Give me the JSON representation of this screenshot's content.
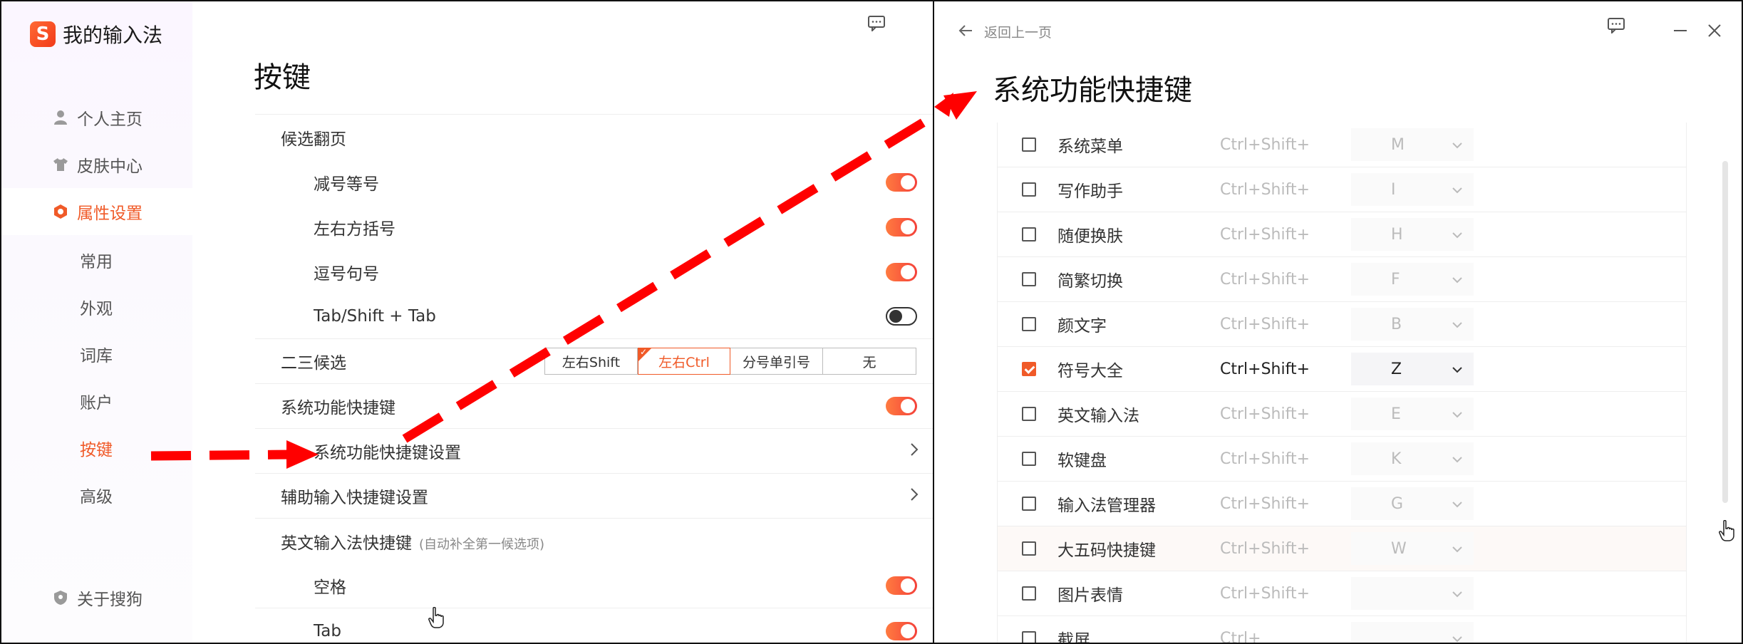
{
  "left": {
    "app_title": "我的输入法",
    "logo_char": "S",
    "nav": {
      "home": "个人主页",
      "skin": "皮肤中心",
      "props": "属性设置",
      "sub": [
        "常用",
        "外观",
        "词库",
        "账户",
        "按键",
        "高级"
      ],
      "active_sub": "按键",
      "about": "关于搜狗"
    },
    "page_title": "按键",
    "sections": {
      "candidate_page": "候选翻页",
      "minus_equal": "减号等号",
      "brackets": "左右方括号",
      "comma_period": "逗号句号",
      "tab_shift": "Tab/Shift + Tab",
      "two_three": "二三候选",
      "two_three_options": [
        "左右Shift",
        "左右Ctrl",
        "分号单引号",
        "无"
      ],
      "two_three_selected": "左右Ctrl",
      "sys_shortcut": "系统功能快捷键",
      "sys_shortcut_settings": "系统功能快捷键设置",
      "aux_shortcut_settings": "辅助输入快捷键设置",
      "en_shortcut": "英文输入法快捷键",
      "en_shortcut_note": "(自动补全第一候选项)",
      "space": "空格",
      "tab": "Tab"
    },
    "toggles": {
      "minus_equal": true,
      "brackets": true,
      "comma_period": true,
      "tab_shift": false,
      "sys_shortcut": true,
      "space": true,
      "tab": true
    }
  },
  "right": {
    "back_label": "返回上一页",
    "title": "系统功能快捷键",
    "rows": [
      {
        "name": "系统菜单",
        "mod": "Ctrl+Shift+",
        "key": "M",
        "checked": false
      },
      {
        "name": "写作助手",
        "mod": "Ctrl+Shift+",
        "key": "I",
        "checked": false
      },
      {
        "name": "随便换肤",
        "mod": "Ctrl+Shift+",
        "key": "H",
        "checked": false
      },
      {
        "name": "简繁切换",
        "mod": "Ctrl+Shift+",
        "key": "F",
        "checked": false
      },
      {
        "name": "颜文字",
        "mod": "Ctrl+Shift+",
        "key": "B",
        "checked": false
      },
      {
        "name": "符号大全",
        "mod": "Ctrl+Shift+",
        "key": "Z",
        "checked": true
      },
      {
        "name": "英文输入法",
        "mod": "Ctrl+Shift+",
        "key": "E",
        "checked": false
      },
      {
        "name": "软键盘",
        "mod": "Ctrl+Shift+",
        "key": "K",
        "checked": false
      },
      {
        "name": "输入法管理器",
        "mod": "Ctrl+Shift+",
        "key": "G",
        "checked": false
      },
      {
        "name": "大五码快捷键",
        "mod": "Ctrl+Shift+",
        "key": "W",
        "checked": false
      },
      {
        "name": "图片表情",
        "mod": "Ctrl+Shift+",
        "key": "",
        "checked": false
      },
      {
        "name": "截屏",
        "mod": "Ctrl+",
        "key": "",
        "checked": false
      }
    ]
  },
  "colors": {
    "accent": "#f05a28",
    "annotation_arrow": "#ff0000"
  },
  "icons": {
    "user": "user-icon",
    "shirt": "shirt-icon",
    "settings": "hexagon-settings-icon",
    "about": "shield-icon",
    "feedback": "message-icon",
    "back": "arrow-left-icon",
    "minimize": "minimize-icon",
    "close": "close-icon",
    "chevron": "chevron-right-icon",
    "dropdown": "chevron-down-icon",
    "cursor": "hand-cursor-icon"
  }
}
